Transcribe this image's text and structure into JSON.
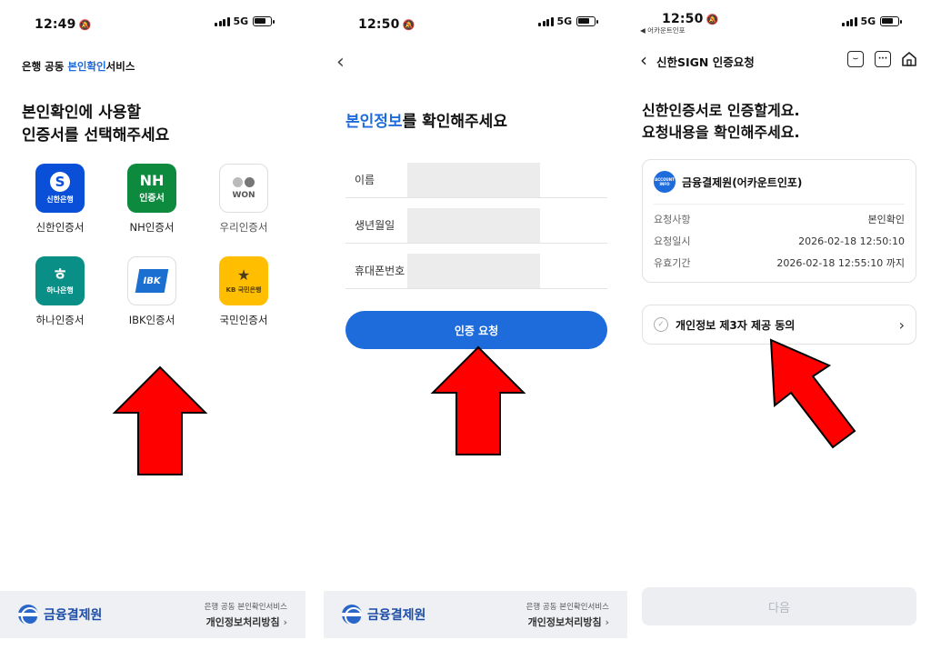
{
  "panel1": {
    "status": {
      "time": "12:49",
      "network": "5G"
    },
    "service_prefix": "은행 공동 ",
    "service_highlight": "본인확인",
    "service_suffix": "서비스",
    "heading_line1": "본인확인에 사용할",
    "heading_line2": "인증서를 선택해주세요",
    "certs": [
      {
        "label": "신한인증서",
        "icon_text": "신한은행",
        "color": "#0a4fd8"
      },
      {
        "label": "NH인증서",
        "icon_text_top": "NH",
        "icon_text": "인증서",
        "color": "#0d8a3e"
      },
      {
        "label": "우리인증서",
        "icon_text": "WON",
        "color": "#ffffff"
      },
      {
        "label": "하나인증서",
        "icon_text": "하나은행",
        "color": "#0a8f86"
      },
      {
        "label": "IBK인증서",
        "icon_text": "IBK",
        "color": "#ffffff"
      },
      {
        "label": "국민인증서",
        "icon_text": "KB 국민은행",
        "color": "#ffbf00"
      }
    ],
    "footer": {
      "logo_text": "금융결제원",
      "small_text": "은행 공동 본인확인서비스",
      "link_text": "개인정보처리방침"
    }
  },
  "panel2": {
    "status": {
      "time": "12:50",
      "network": "5G"
    },
    "title_highlight": "본인정보",
    "title_rest": "를 확인해주세요",
    "fields": [
      {
        "label": "이름",
        "value": ""
      },
      {
        "label": "생년월일",
        "value": ""
      },
      {
        "label": "휴대폰번호",
        "value": ""
      }
    ],
    "submit_label": "인증 요청",
    "footer": {
      "logo_text": "금융결제원",
      "small_text": "은행 공동 본인확인서비스",
      "link_text": "개인정보처리방침"
    }
  },
  "panel3": {
    "status": {
      "time": "12:50",
      "network": "5G",
      "back_app": "◀ 어카운트인포"
    },
    "nav_title": "신한SIGN 인증요청",
    "heading_line1": "신한인증서로 인증할게요.",
    "heading_line2": "요청내용을 확인해주세요.",
    "org_badge": "ACCOUNT INFO",
    "org_name": "금융결제원(어카운트인포)",
    "details": [
      {
        "key": "요청사항",
        "value": "본인확인"
      },
      {
        "key": "요청일시",
        "value": "2026-02-18 12:50:10"
      },
      {
        "key": "유효기간",
        "value": "2026-02-18 12:55:10 까지"
      }
    ],
    "consent_label": "개인정보 제3자 제공 동의",
    "next_label": "다음"
  },
  "colors": {
    "accent": "#1e6bdc",
    "arrow": "#ff0000"
  }
}
